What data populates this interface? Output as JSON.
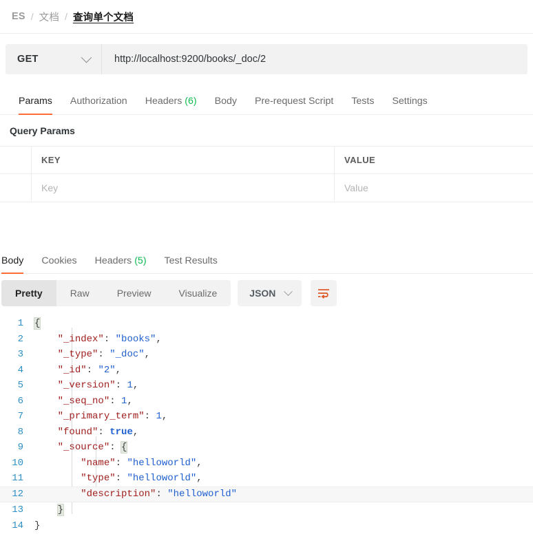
{
  "breadcrumb": {
    "items": [
      "ES",
      "文档",
      "查询单个文档"
    ],
    "separator": "/"
  },
  "request": {
    "method": "GET",
    "url": "http://localhost:9200/books/_doc/2",
    "tabs": [
      {
        "label": "Params",
        "count": "",
        "active": true
      },
      {
        "label": "Authorization",
        "count": "",
        "active": false
      },
      {
        "label": "Headers",
        "count": "(6)",
        "active": false
      },
      {
        "label": "Body",
        "count": "",
        "active": false
      },
      {
        "label": "Pre-request Script",
        "count": "",
        "active": false
      },
      {
        "label": "Tests",
        "count": "",
        "active": false
      },
      {
        "label": "Settings",
        "count": "",
        "active": false
      }
    ],
    "query_params": {
      "title": "Query Params",
      "columns": [
        "KEY",
        "VALUE"
      ],
      "rows": [
        {
          "key_placeholder": "Key",
          "value_placeholder": "Value"
        }
      ]
    }
  },
  "response": {
    "tabs": [
      {
        "label": "Body",
        "count": "",
        "active": true
      },
      {
        "label": "Cookies",
        "count": "",
        "active": false
      },
      {
        "label": "Headers",
        "count": "(5)",
        "active": false
      },
      {
        "label": "Test Results",
        "count": "",
        "active": false
      }
    ],
    "view_modes": [
      {
        "label": "Pretty",
        "active": true
      },
      {
        "label": "Raw",
        "active": false
      },
      {
        "label": "Preview",
        "active": false
      },
      {
        "label": "Visualize",
        "active": false
      }
    ],
    "format": "JSON",
    "wrap_icon": "word-wrap-icon",
    "body_lines": [
      {
        "no": "1",
        "segments": [
          {
            "t": "{",
            "c": "brk"
          }
        ]
      },
      {
        "no": "2",
        "segments": [
          {
            "t": "    ",
            "c": "p"
          },
          {
            "t": "\"_index\"",
            "c": "k"
          },
          {
            "t": ": ",
            "c": "p"
          },
          {
            "t": "\"books\"",
            "c": "s"
          },
          {
            "t": ",",
            "c": "p"
          }
        ]
      },
      {
        "no": "3",
        "segments": [
          {
            "t": "    ",
            "c": "p"
          },
          {
            "t": "\"_type\"",
            "c": "k"
          },
          {
            "t": ": ",
            "c": "p"
          },
          {
            "t": "\"_doc\"",
            "c": "s"
          },
          {
            "t": ",",
            "c": "p"
          }
        ]
      },
      {
        "no": "4",
        "segments": [
          {
            "t": "    ",
            "c": "p"
          },
          {
            "t": "\"_id\"",
            "c": "k"
          },
          {
            "t": ": ",
            "c": "p"
          },
          {
            "t": "\"2\"",
            "c": "s"
          },
          {
            "t": ",",
            "c": "p"
          }
        ]
      },
      {
        "no": "5",
        "segments": [
          {
            "t": "    ",
            "c": "p"
          },
          {
            "t": "\"_version\"",
            "c": "k"
          },
          {
            "t": ": ",
            "c": "p"
          },
          {
            "t": "1",
            "c": "n"
          },
          {
            "t": ",",
            "c": "p"
          }
        ]
      },
      {
        "no": "6",
        "segments": [
          {
            "t": "    ",
            "c": "p"
          },
          {
            "t": "\"_seq_no\"",
            "c": "k"
          },
          {
            "t": ": ",
            "c": "p"
          },
          {
            "t": "1",
            "c": "n"
          },
          {
            "t": ",",
            "c": "p"
          }
        ]
      },
      {
        "no": "7",
        "segments": [
          {
            "t": "    ",
            "c": "p"
          },
          {
            "t": "\"_primary_term\"",
            "c": "k"
          },
          {
            "t": ": ",
            "c": "p"
          },
          {
            "t": "1",
            "c": "n"
          },
          {
            "t": ",",
            "c": "p"
          }
        ]
      },
      {
        "no": "8",
        "segments": [
          {
            "t": "    ",
            "c": "p"
          },
          {
            "t": "\"found\"",
            "c": "k"
          },
          {
            "t": ": ",
            "c": "p"
          },
          {
            "t": "true",
            "c": "b"
          },
          {
            "t": ",",
            "c": "p"
          }
        ]
      },
      {
        "no": "9",
        "segments": [
          {
            "t": "    ",
            "c": "p"
          },
          {
            "t": "\"_source\"",
            "c": "k"
          },
          {
            "t": ": ",
            "c": "p"
          },
          {
            "t": "{",
            "c": "brk"
          }
        ]
      },
      {
        "no": "10",
        "segments": [
          {
            "t": "        ",
            "c": "p"
          },
          {
            "t": "\"name\"",
            "c": "k"
          },
          {
            "t": ": ",
            "c": "p"
          },
          {
            "t": "\"helloworld\"",
            "c": "s"
          },
          {
            "t": ",",
            "c": "p"
          }
        ]
      },
      {
        "no": "11",
        "segments": [
          {
            "t": "        ",
            "c": "p"
          },
          {
            "t": "\"type\"",
            "c": "k"
          },
          {
            "t": ": ",
            "c": "p"
          },
          {
            "t": "\"helloworld\"",
            "c": "s"
          },
          {
            "t": ",",
            "c": "p"
          }
        ]
      },
      {
        "no": "12",
        "segments": [
          {
            "t": "        ",
            "c": "p"
          },
          {
            "t": "\"description\"",
            "c": "k"
          },
          {
            "t": ": ",
            "c": "p"
          },
          {
            "t": "\"helloworld\"",
            "c": "s"
          }
        ],
        "active": true
      },
      {
        "no": "13",
        "segments": [
          {
            "t": "    ",
            "c": "p"
          },
          {
            "t": "}",
            "c": "brk"
          }
        ]
      },
      {
        "no": "14",
        "segments": [
          {
            "t": "}",
            "c": "p"
          }
        ]
      }
    ]
  },
  "colors": {
    "accent": "#ff6c37",
    "count_green": "#0cbb52",
    "json_key": "#a11f1f",
    "json_value": "#1f5fd0",
    "line_number": "#2d8fc4"
  }
}
